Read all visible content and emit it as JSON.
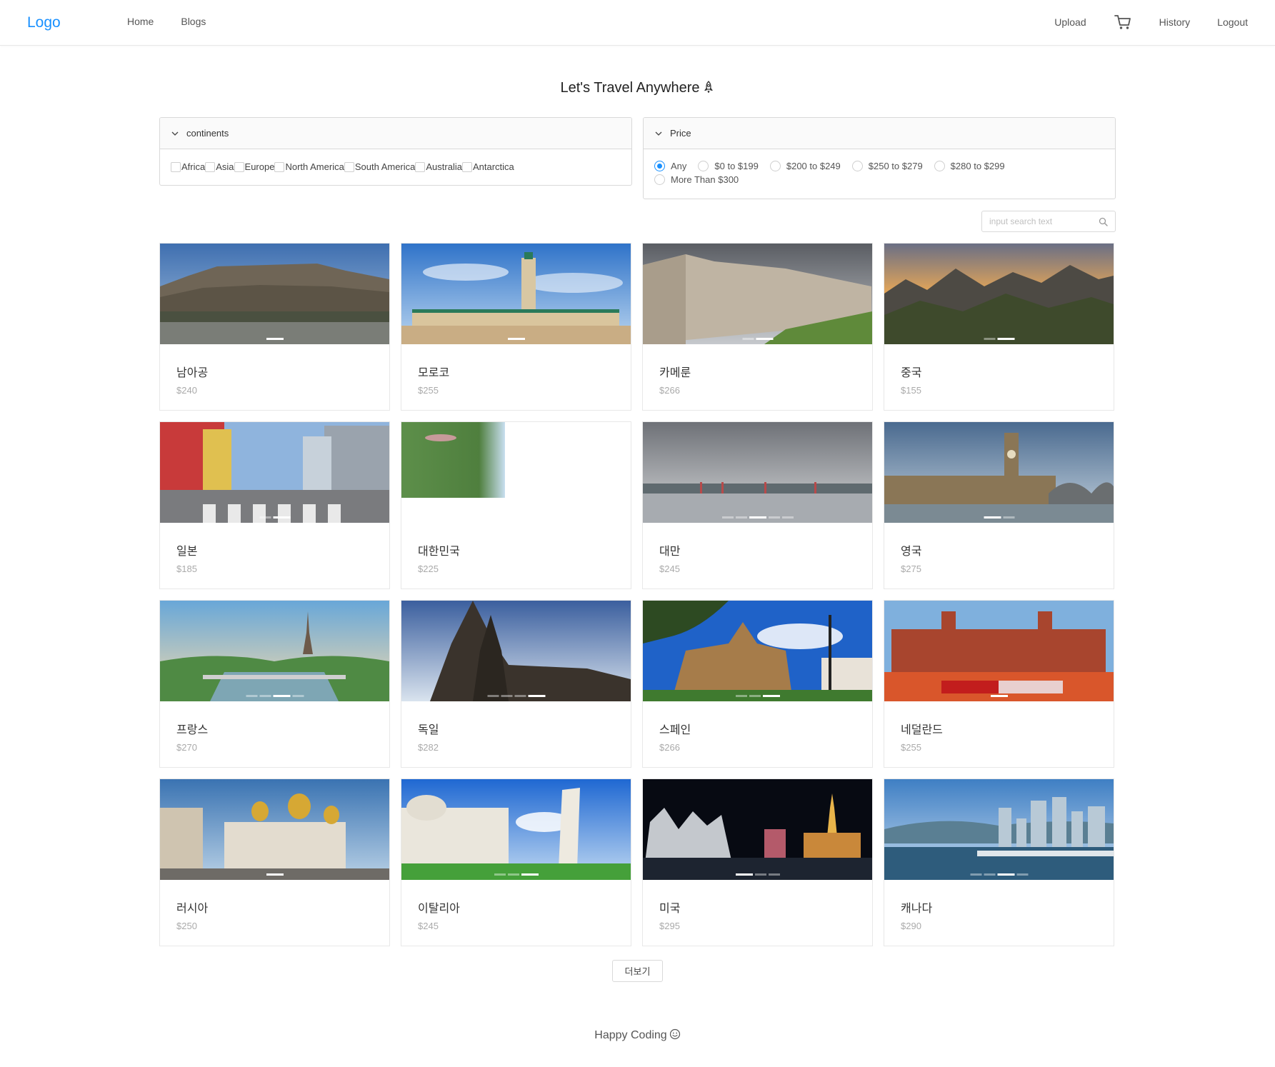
{
  "nav": {
    "logo": "Logo",
    "left": [
      "Home",
      "Blogs"
    ],
    "upload": "Upload",
    "cart_icon": "cart-icon",
    "history": "History",
    "logout": "Logout"
  },
  "title": "Let's Travel Anywhere",
  "filters": {
    "continents": {
      "header": "continents",
      "options": [
        "Africa",
        "Asia",
        "Europe",
        "North America",
        "South America",
        "Australia",
        "Antarctica"
      ]
    },
    "price": {
      "header": "Price",
      "selected": "Any",
      "options": [
        "Any",
        "$0 to $199",
        "$200 to $249",
        "$250 to $279",
        "$280 to $299",
        "More Than $300"
      ]
    }
  },
  "search": {
    "placeholder": "input search text"
  },
  "cards": [
    {
      "name": "남아공",
      "price": "$240",
      "scene": "mountain"
    },
    {
      "name": "모로코",
      "price": "$255",
      "scene": "mosque"
    },
    {
      "name": "카메룬",
      "price": "$266",
      "scene": "building"
    },
    {
      "name": "중국",
      "price": "$155",
      "scene": "peaks"
    },
    {
      "name": "일본",
      "price": "$185",
      "scene": "street"
    },
    {
      "name": "대한민국",
      "price": "$225",
      "scene": "korea"
    },
    {
      "name": "대만",
      "price": "$245",
      "scene": "harbor"
    },
    {
      "name": "영국",
      "price": "$275",
      "scene": "london"
    },
    {
      "name": "프랑스",
      "price": "$270",
      "scene": "paris"
    },
    {
      "name": "독일",
      "price": "$282",
      "scene": "cathedral"
    },
    {
      "name": "스페인",
      "price": "$266",
      "scene": "spain"
    },
    {
      "name": "네덜란드",
      "price": "$255",
      "scene": "amsterdam"
    },
    {
      "name": "러시아",
      "price": "$250",
      "scene": "russia"
    },
    {
      "name": "이탈리아",
      "price": "$245",
      "scene": "pisa"
    },
    {
      "name": "미국",
      "price": "$295",
      "scene": "vegas"
    },
    {
      "name": "캐나다",
      "price": "$290",
      "scene": "vancouver"
    }
  ],
  "more_button": "더보기",
  "footer": {
    "text": "Happy Coding",
    "icon": "smile-icon"
  },
  "colors": {
    "accent": "#1890ff",
    "border": "#e8e8e8"
  }
}
